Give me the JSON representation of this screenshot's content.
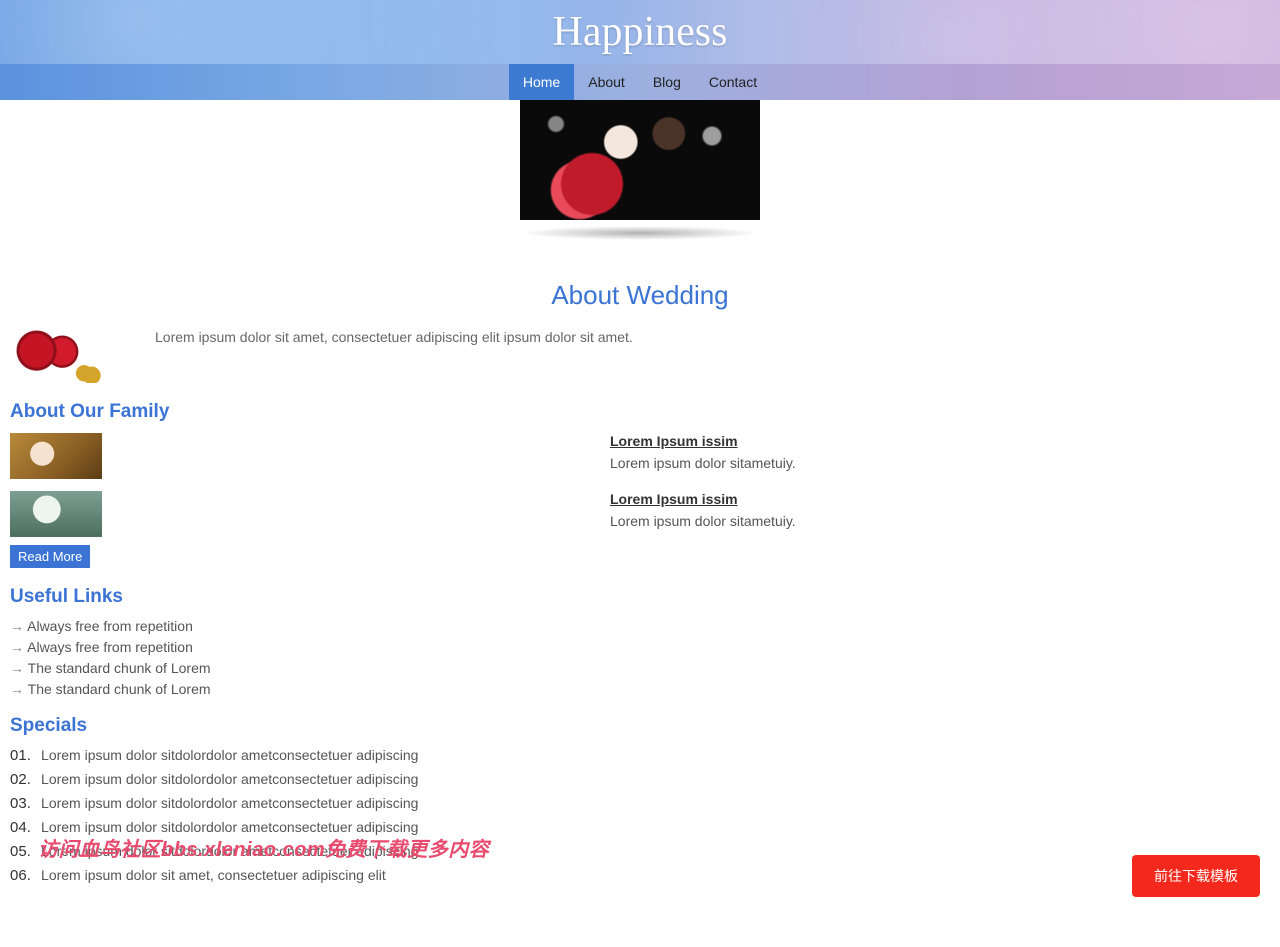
{
  "header": {
    "logo": "Happiness"
  },
  "nav": {
    "items": [
      {
        "label": "Home",
        "active": true
      },
      {
        "label": "About",
        "active": false
      },
      {
        "label": "Blog",
        "active": false
      },
      {
        "label": "Contact",
        "active": false
      }
    ]
  },
  "about": {
    "heading": "About Wedding",
    "text": "Lorem ipsum dolor sit amet, consectetuer adipiscing elit ipsum dolor sit amet."
  },
  "family": {
    "heading": "About Our Family",
    "items": [
      {
        "title": "Lorem Ipsum issim",
        "text": "Lorem ipsum dolor sitametuiy."
      },
      {
        "title": "Lorem Ipsum issim",
        "text": "Lorem ipsum dolor sitametuiy."
      }
    ],
    "read_more": "Read More"
  },
  "links": {
    "heading": "Useful Links",
    "items": [
      "Always free from repetition",
      "Always free from repetition",
      "The standard chunk of Lorem",
      "The standard chunk of Lorem"
    ]
  },
  "specials": {
    "heading": "Specials",
    "items": [
      "Lorem ipsum dolor sitdolordolor ametconsectetuer adipiscing",
      "Lorem ipsum dolor sitdolordolor ametconsectetuer adipiscing",
      "Lorem ipsum dolor sitdolordolor ametconsectetuer adipiscing",
      "Lorem ipsum dolor sitdolordolor ametconsectetuer adipiscing",
      "Lorem ipsum dolor sitdolordolor ametconsectetuer adipiscing",
      "Lorem ipsum dolor sit amet, consectetuer adipiscing elit"
    ]
  },
  "watermark": "访问血鸟社区bbs.xleniao.com免费下载更多内容",
  "float_button": "前往下载模板"
}
